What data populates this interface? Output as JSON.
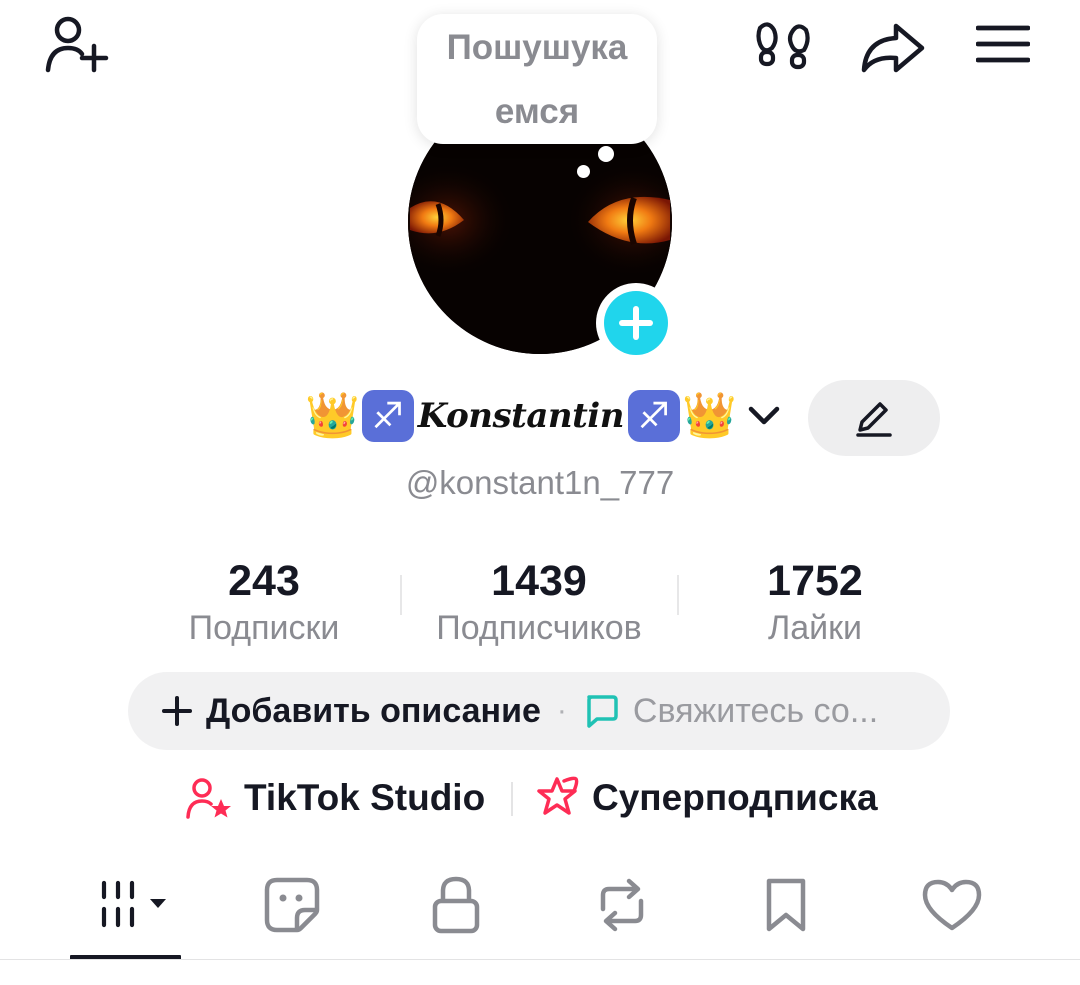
{
  "topbar": {
    "add_friend_icon": "person-plus-icon",
    "footprints_icon": "footprints-icon",
    "share_icon": "share-arrow-icon",
    "menu_icon": "hamburger-menu-icon"
  },
  "status_bubble": {
    "line1": "Пошушука",
    "line2": "емся"
  },
  "profile": {
    "display_name": "Konstantin",
    "name_emojis_left": [
      "👑",
      "♐"
    ],
    "name_emojis_right": [
      "♐",
      "👑"
    ],
    "username": "@konstant1n_777"
  },
  "stats": [
    {
      "value": "243",
      "label": "Подписки"
    },
    {
      "value": "1439",
      "label": "Подписчиков"
    },
    {
      "value": "1752",
      "label": "Лайки"
    }
  ],
  "description": {
    "add_label": "Добавить описание",
    "separator": "·",
    "contact_label": "Свяжитесь со..."
  },
  "links": {
    "studio_label": "TikTok Studio",
    "subscription_label": "Суперподписка"
  },
  "tabs": [
    {
      "name": "videos",
      "icon": "grid-icon",
      "active": true
    },
    {
      "name": "stickers",
      "icon": "sticker-icon",
      "active": false
    },
    {
      "name": "private",
      "icon": "lock-icon",
      "active": false
    },
    {
      "name": "reposts",
      "icon": "repost-icon",
      "active": false
    },
    {
      "name": "favorites",
      "icon": "bookmark-icon",
      "active": false
    },
    {
      "name": "liked",
      "icon": "heart-icon",
      "active": false
    }
  ],
  "colors": {
    "accent_cyan": "#20d5ec",
    "accent_pink": "#fe2c55",
    "text_primary": "#161823",
    "text_secondary": "#8a8b91",
    "pill_bg": "#f1f1f2"
  }
}
